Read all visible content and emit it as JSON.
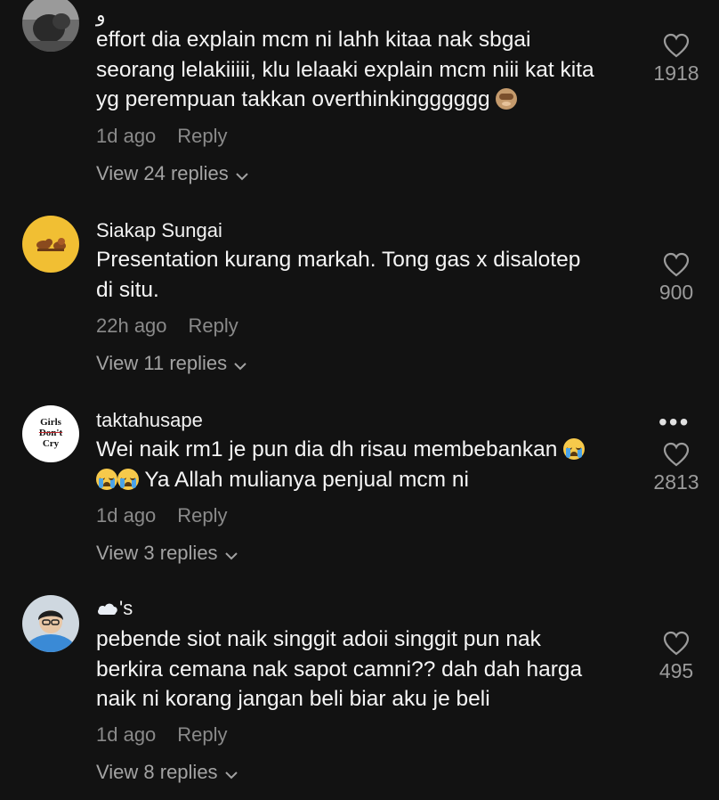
{
  "comments": [
    {
      "username": "و",
      "text_lines": [
        "effort dia explain mcm ni lahh kitaa nak sbgai",
        "seorang lelakiiiii, klu lelaaki explain mcm niii kat kita",
        "yg perempuan takkan overthinkingggggg"
      ],
      "time": "1d ago",
      "reply_label": "Reply",
      "view_replies": "View 24 replies",
      "likes": "1918",
      "avatar_icon": "dark-photo-avatar"
    },
    {
      "username": "Siakap Sungai",
      "text_lines": [
        "Presentation kurang markah. Tong gas x disalotep",
        "di situ."
      ],
      "time": "22h ago",
      "reply_label": "Reply",
      "view_replies": "View 11 replies",
      "likes": "900",
      "avatar_icon": "yellow-birds-avatar"
    },
    {
      "username": "taktahusape",
      "text_lines": [
        "Wei naik rm1 je pun dia dh risau membebankan",
        "Ya Allah mulianya penjual mcm ni"
      ],
      "time": "1d ago",
      "reply_label": "Reply",
      "view_replies": "View 3 replies",
      "likes": "2813",
      "avatar_text": [
        "Girls",
        "Don't",
        "Cry"
      ],
      "more_label": "•••"
    },
    {
      "username": "'s",
      "text_lines": [
        "pebende siot naik singgit adoii singgit pun nak",
        "berkira cemana nak sapot camni?? dah dah harga",
        "naik ni korang jangan beli biar aku je beli"
      ],
      "time": "1d ago",
      "reply_label": "Reply",
      "view_replies": "View 8 replies",
      "likes": "495",
      "avatar_icon": "person-photo-avatar"
    }
  ],
  "colors": {
    "background": "#121212",
    "text": "#f5f5f5",
    "meta": "#8a8a8a",
    "like_count": "#9b9b9b"
  }
}
